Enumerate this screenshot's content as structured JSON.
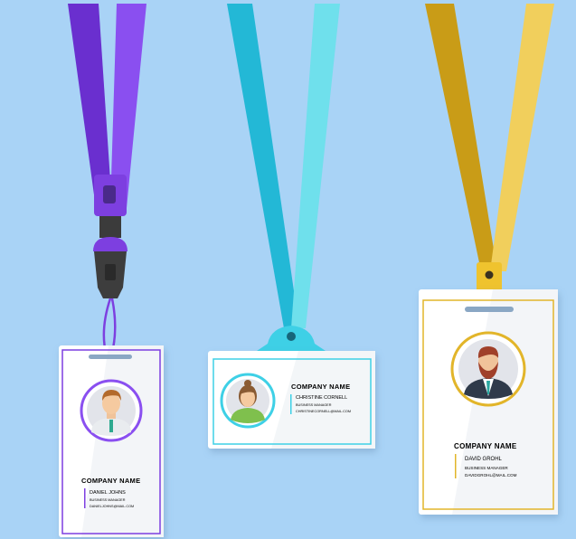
{
  "colors": {
    "background": "#a9d3f6",
    "purple": "#7d3fe0",
    "cyan": "#3ed0e6",
    "gold": "#e2b52a",
    "card": "#ffffff"
  },
  "badges": [
    {
      "id": "purple-badge",
      "company": "COMPANY NAME",
      "name": "DANIEL JOHNS",
      "role": "BUSINESS MANAGER",
      "email": "DANIELJOHNS@MAIL.COM"
    },
    {
      "id": "cyan-badge",
      "company": "COMPANY NAME",
      "name": "CHRISTINE CORNELL",
      "role": "BUSINESS MANAGER",
      "email": "CHRISTINECORNELL@MAIL.COM"
    },
    {
      "id": "gold-badge",
      "company": "COMPANY NAME",
      "name": "DAVID GROHL",
      "role": "BUSINESS MANAGER",
      "email": "DAVIDGROHL@MAIL.COM"
    }
  ]
}
